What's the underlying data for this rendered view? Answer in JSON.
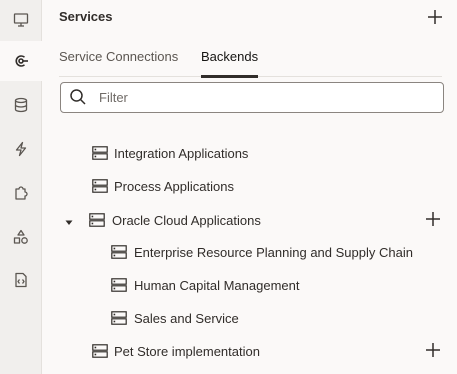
{
  "sidebar": {
    "items": [
      {
        "icon": "monitor-icon"
      },
      {
        "icon": "service-connection-icon",
        "active": true
      },
      {
        "icon": "database-icon"
      },
      {
        "icon": "lightning-icon"
      },
      {
        "icon": "puzzle-icon"
      },
      {
        "icon": "shapes-icon"
      },
      {
        "icon": "code-file-icon"
      }
    ]
  },
  "panel": {
    "title": "Services",
    "tabs": [
      {
        "label": "Service Connections",
        "active": false
      },
      {
        "label": "Backends",
        "active": true
      }
    ],
    "filter": {
      "placeholder": "Filter",
      "value": ""
    }
  },
  "tree": [
    {
      "label": "Integration Applications"
    },
    {
      "label": "Process Applications"
    },
    {
      "label": "Oracle Cloud Applications",
      "expanded": true
    },
    {
      "label": "Enterprise Resource Planning and Supply Chain"
    },
    {
      "label": "Human Capital Management"
    },
    {
      "label": "Sales and Service"
    },
    {
      "label": "Pet Store implementation"
    }
  ],
  "colors": {
    "text": "#312d2a",
    "rail": "#f1efed",
    "background": "#fbf9f8"
  }
}
